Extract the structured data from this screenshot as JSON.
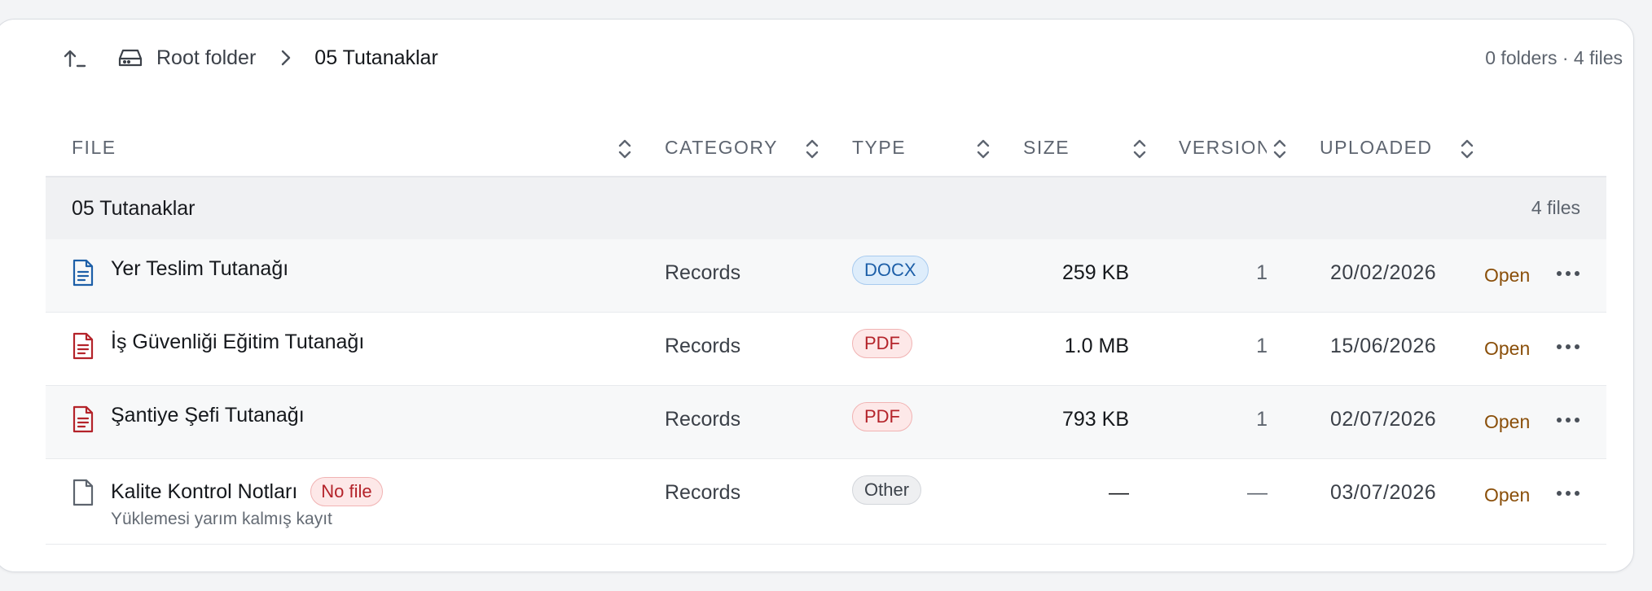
{
  "breadcrumb": {
    "root": "Root folder",
    "current": "05 Tutanaklar"
  },
  "summary": "0 folders · 4 files",
  "columns": {
    "file": "FILE",
    "category": "CATEGORY",
    "type": "TYPE",
    "size": "SIZE",
    "version": "VERSION",
    "uploaded": "UPLOADED"
  },
  "group": {
    "name": "05 Tutanaklar",
    "count": "4 files"
  },
  "rows": [
    {
      "name": "Yer Teslim Tutanağı",
      "category": "Records",
      "type": "DOCX",
      "size": "259 KB",
      "version": "1",
      "uploaded": "20/02/2026",
      "action": "Open",
      "icon": "docx-file-icon"
    },
    {
      "name": "İş Güvenliği Eğitim Tutanağı",
      "category": "Records",
      "type": "PDF",
      "size": "1.0 MB",
      "version": "1",
      "uploaded": "15/06/2026",
      "action": "Open",
      "icon": "pdf-file-icon"
    },
    {
      "name": "Şantiye Şefi Tutanağı",
      "category": "Records",
      "type": "PDF",
      "size": "793 KB",
      "version": "1",
      "uploaded": "02/07/2026",
      "action": "Open",
      "icon": "pdf-file-icon"
    },
    {
      "name": "Kalite Kontrol Notları",
      "badge": "No file",
      "subtitle": "Yüklemesi yarım kalmış kayıt",
      "category": "Records",
      "type": "Other",
      "size": "—",
      "version": "—",
      "uploaded": "03/07/2026",
      "action": "Open",
      "icon": "blank-file-icon"
    }
  ],
  "colors": {
    "accent_open": "#8a4f0a",
    "docx": "#1d5fa8",
    "pdf": "#b4232a"
  }
}
